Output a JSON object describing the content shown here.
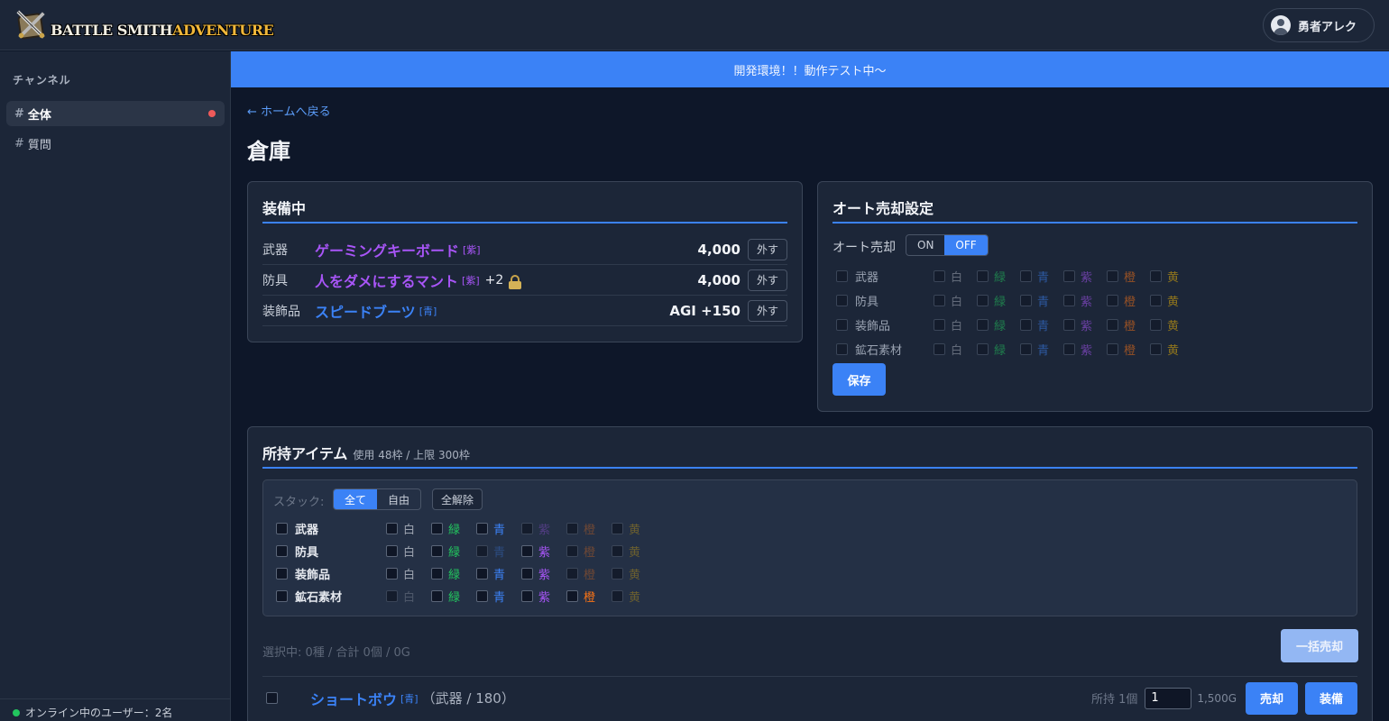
{
  "app": {
    "logo_word1": "BATTLE SMITH",
    "logo_word2": "ADVENTURE",
    "user_name": "勇者アレク"
  },
  "sidebar": {
    "title": "チャンネル",
    "channels": [
      {
        "hash": "#",
        "label": "全体",
        "active": true,
        "unread": true
      },
      {
        "hash": "#",
        "label": "質問",
        "active": false,
        "unread": false
      }
    ],
    "footer": "オンライン中のユーザー：2名"
  },
  "banner": "開発環境！！動作テスト中〜",
  "back_link": "← ホームへ戻る",
  "page_title": "倉庫",
  "equipped": {
    "title": "装備中",
    "unequip_label": "外す",
    "rows": [
      {
        "slot": "武器",
        "name": "ゲーミングキーボード",
        "rarity": "[紫]",
        "color": "#a855f7",
        "plus": "",
        "locked": false,
        "value": "4,000"
      },
      {
        "slot": "防具",
        "name": "人をダメにするマント",
        "rarity": "[紫]",
        "color": "#a855f7",
        "plus": "+2",
        "locked": true,
        "value": "4,000"
      },
      {
        "slot": "装飾品",
        "name": "スピードブーツ",
        "rarity": "[青]",
        "color": "#3b82f6",
        "plus": "",
        "locked": false,
        "value": "AGI +150"
      }
    ]
  },
  "autosell": {
    "title": "オート売却設定",
    "label": "オート売却",
    "on_label": "ON",
    "off_label": "OFF",
    "state": "OFF",
    "save_label": "保存",
    "categories": [
      "武器",
      "防具",
      "装飾品",
      "鉱石素材"
    ]
  },
  "rarities": [
    {
      "label": "白",
      "color": "#9ca3af"
    },
    {
      "label": "緑",
      "color": "#22c55e"
    },
    {
      "label": "青",
      "color": "#3b82f6"
    },
    {
      "label": "紫",
      "color": "#a855f7"
    },
    {
      "label": "橙",
      "color": "#f97316"
    },
    {
      "label": "黄",
      "color": "#eab308"
    }
  ],
  "inventory": {
    "title": "所持アイテム",
    "usage": "使用 48枠 / 上限 300枠",
    "stack_label": "スタック:",
    "stack_all": "全て",
    "stack_free": "自由",
    "clear_all": "全解除",
    "categories": [
      "武器",
      "防具",
      "装飾品",
      "鉱石素材"
    ],
    "availability": [
      [
        true,
        true,
        true,
        false,
        false,
        false
      ],
      [
        true,
        true,
        false,
        true,
        false,
        false
      ],
      [
        true,
        true,
        true,
        true,
        false,
        false
      ],
      [
        false,
        true,
        true,
        true,
        true,
        false
      ]
    ],
    "selection_info": "選択中: 0種 / 合計 0個 / 0G",
    "bulk_sell": "一括売却",
    "items": [
      {
        "name": "ショートボウ",
        "rarity": "[青]",
        "color": "#3b82f6",
        "meta": "（武器 / 180）",
        "owned": "所持 1個",
        "qty": "1",
        "price": "1,500G",
        "sell": "売却",
        "equip": "装備"
      }
    ]
  }
}
